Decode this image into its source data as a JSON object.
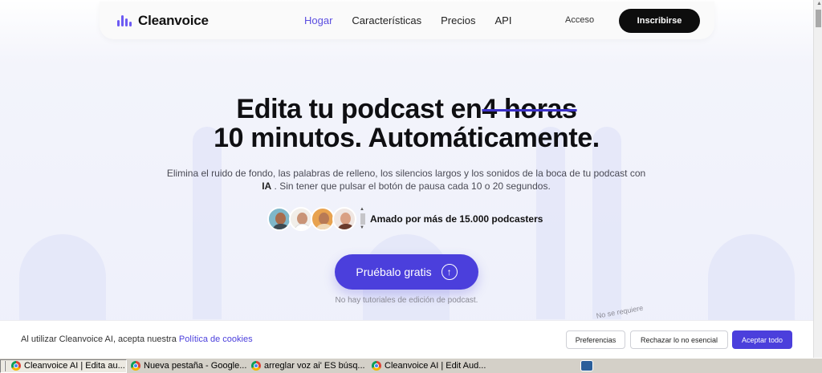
{
  "brand": {
    "name": "Cleanvoice",
    "accent": "#4b3fdc",
    "logo_color": "#6d5bf3"
  },
  "nav": {
    "links": [
      {
        "label": "Hogar",
        "active": true
      },
      {
        "label": "Características",
        "active": false
      },
      {
        "label": "Precios",
        "active": false
      },
      {
        "label": "API",
        "active": false
      }
    ],
    "login": "Acceso",
    "signup": "Inscribirse"
  },
  "hero": {
    "title_start": "Edita tu podcast en",
    "title_struck": "4 horas",
    "title_line2": "10 minutos. Automáticamente.",
    "subtitle_part1": "Elimina el ruido de fondo, las palabras de relleno, los silencios largos y los sonidos de la boca de tu podcast con",
    "subtitle_bold": "IA",
    "subtitle_part2": ". Sin tener que pulsar el botón de pausa cada 10 o 20 segundos.",
    "social_proof": "Amado por más de 15.000 podcasters",
    "cta_label": "Pruébalo gratis",
    "cta_icon": "arrow-up-circle-icon",
    "cta_note": "No hay tutoriales de edición de podcast.",
    "rotated_note": "No se requiere"
  },
  "cookie_bar": {
    "text": "Al utilizar Cleanvoice AI, acepta nuestra",
    "link": "Política de cookies",
    "preferences": "Preferencias",
    "reject": "Rechazar lo no esencial",
    "accept": "Aceptar todo"
  },
  "taskbar": {
    "items": [
      {
        "label": "Cleanvoice AI | Edita au...",
        "icon": "chrome-icon",
        "active": true
      },
      {
        "label": "Nueva pestaña - Google...",
        "icon": "chrome-icon",
        "active": false
      },
      {
        "label": "arreglar voz ai' ES búsq...",
        "icon": "chrome-icon",
        "active": false
      },
      {
        "label": "Cleanvoice AI | Edit Aud...",
        "icon": "chrome-icon",
        "active": false
      }
    ]
  }
}
